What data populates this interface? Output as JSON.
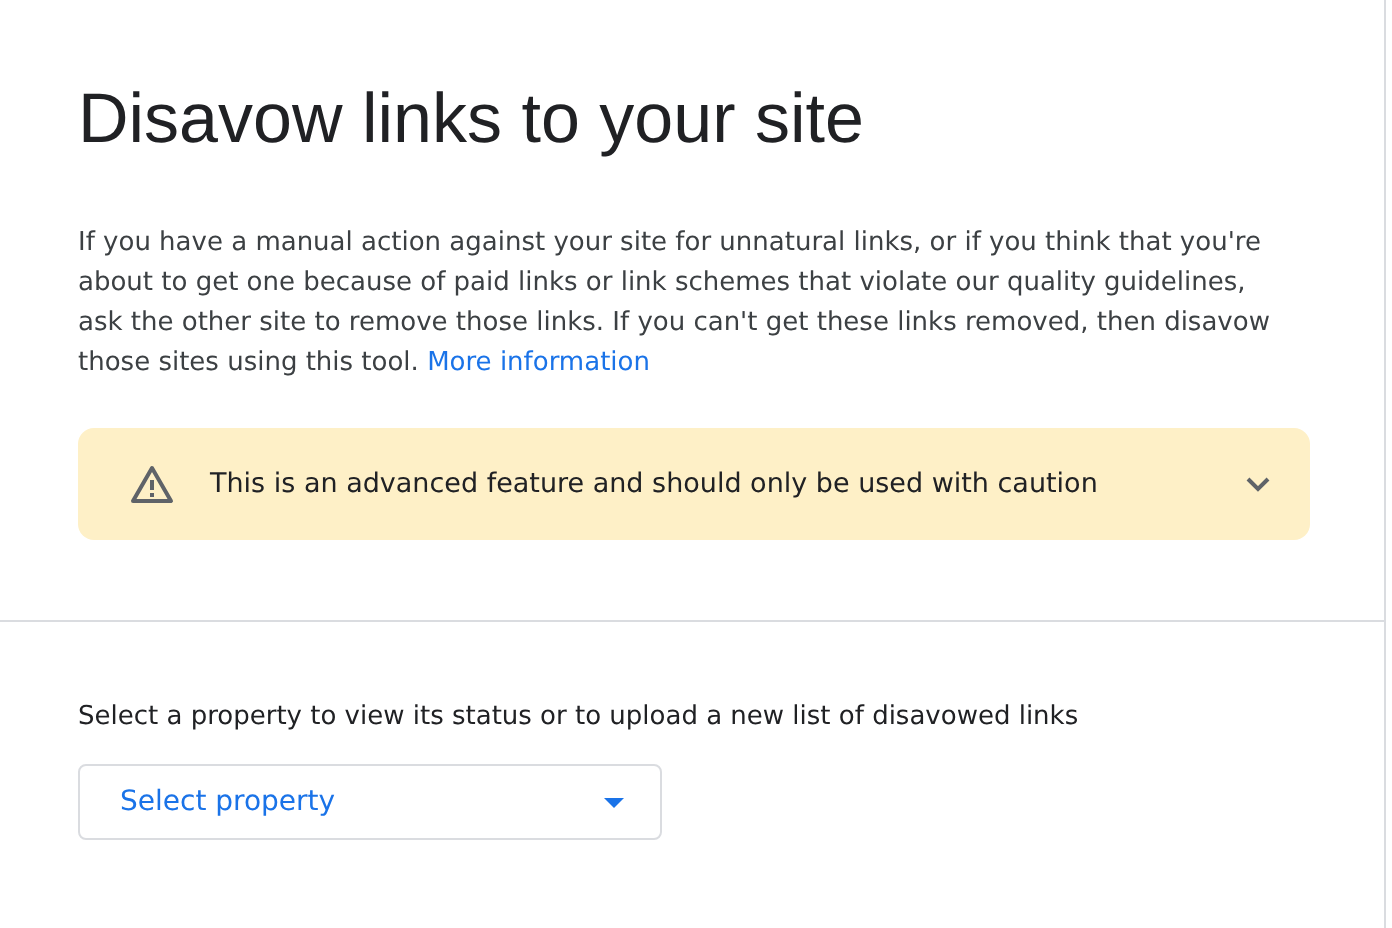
{
  "title": "Disavow links to your site",
  "intro": {
    "text": "If you have a manual action against your site for unnatural links, or if you think that you're about to get one because of paid links or link schemes that violate our quality guidelines, ask the other site to remove those links. If you can't get these links removed, then disavow those sites using this tool.",
    "link": "More information"
  },
  "warning": {
    "text": "This is an advanced feature and should only be used with caution",
    "expanded": false
  },
  "property_label": "Select a property to view its status or to upload a new list of disavowed links",
  "property_select": {
    "placeholder": "Select property"
  }
}
